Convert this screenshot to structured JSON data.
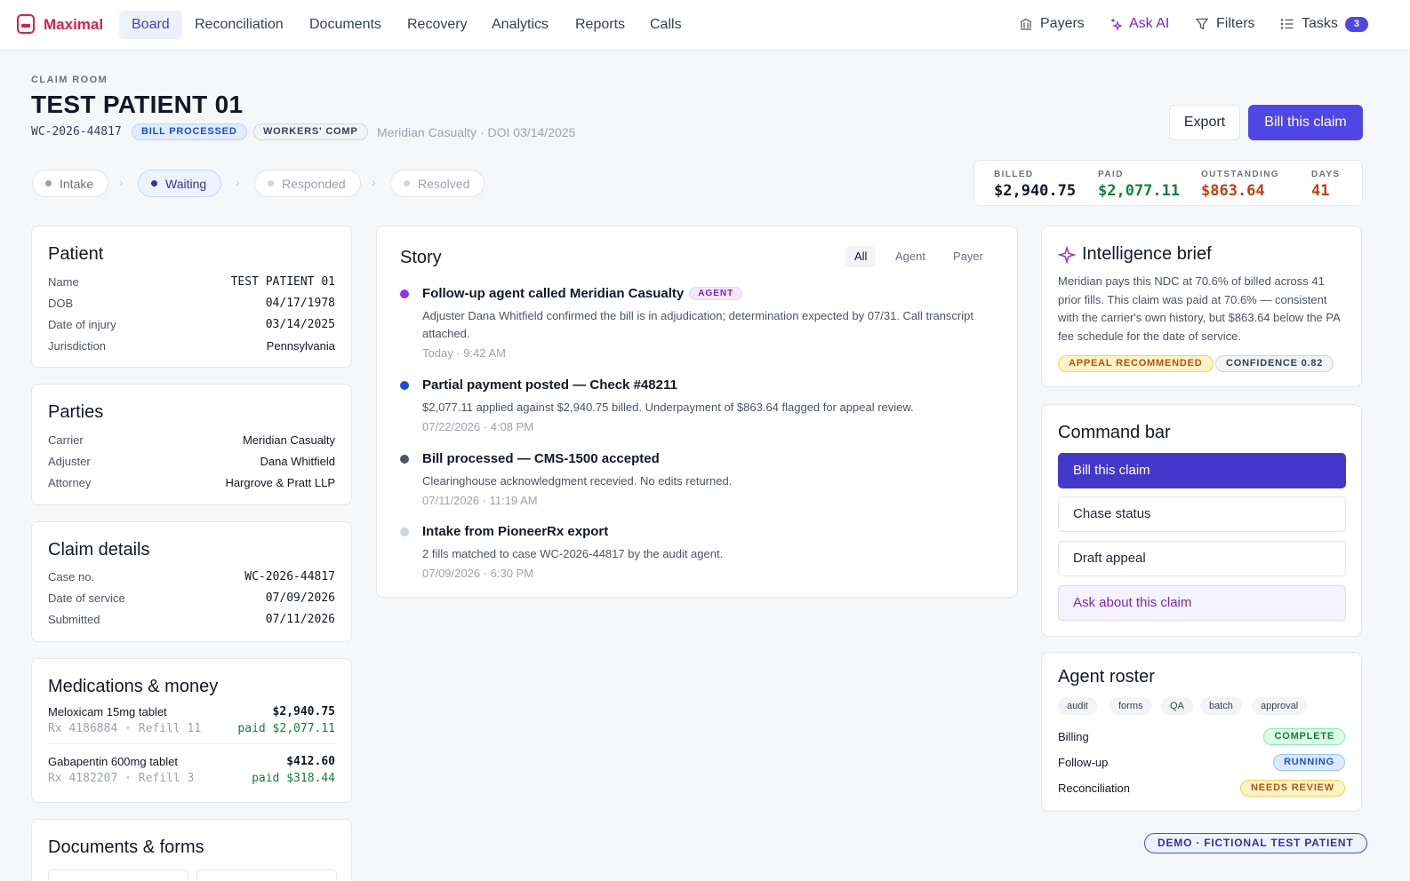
{
  "nav": {
    "brand": "Maximal",
    "tabs": [
      "Board",
      "Reconciliation",
      "Documents",
      "Recovery",
      "Analytics",
      "Reports",
      "Calls"
    ],
    "active_tab": "Board",
    "payers": "Payers",
    "ask_ai": "Ask AI",
    "filters": "Filters",
    "tasks": "Tasks",
    "tasks_count": "3"
  },
  "header": {
    "eyebrow": "CLAIM ROOM",
    "title": "TEST PATIENT 01",
    "case_id": "WC-2026-44817",
    "status_pill": "BILL PROCESSED",
    "type_pill": "WORKERS' COMP",
    "meta": "Meridian Casualty · DOI 03/14/2025",
    "export_label": "Export",
    "bill_label": "Bill this claim"
  },
  "steps": [
    "Intake",
    "Waiting",
    "Responded",
    "Resolved"
  ],
  "kpis": {
    "billed_label": "BILLED",
    "billed": "$2,940.75",
    "paid_label": "PAID",
    "paid": "$2,077.11",
    "outstanding_label": "OUTSTANDING",
    "outstanding": "$863.64",
    "days_label": "DAYS",
    "days": "41"
  },
  "colors": {
    "accent": "#4f46e5",
    "paid": "#15803d",
    "outstanding": "#c2410c"
  },
  "patient": {
    "title": "Patient",
    "rows": [
      {
        "k": "Name",
        "v": "TEST PATIENT 01"
      },
      {
        "k": "DOB",
        "v": "04/17/1978"
      },
      {
        "k": "Date of injury",
        "v": "03/14/2025"
      },
      {
        "k": "Jurisdiction",
        "v": "Pennsylvania"
      }
    ]
  },
  "parties": {
    "title": "Parties",
    "rows": [
      {
        "k": "Carrier",
        "v": "Meridian Casualty"
      },
      {
        "k": "Adjuster",
        "v": "Dana Whitfield"
      },
      {
        "k": "Attorney",
        "v": "Hargrove & Pratt LLP"
      }
    ]
  },
  "claim": {
    "title": "Claim details",
    "rows": [
      {
        "k": "Case no.",
        "v": "WC-2026-44817"
      },
      {
        "k": "Date of service",
        "v": "07/09/2026"
      },
      {
        "k": "Submitted",
        "v": "07/11/2026"
      }
    ]
  },
  "meds": {
    "title": "Medications & money",
    "items": [
      {
        "name": "Meloxicam 15mg tablet",
        "billed": "$2,940.75",
        "rx": "Rx 4186884 · Refill 11",
        "paid": "paid $2,077.11"
      },
      {
        "name": "Gabapentin 600mg tablet",
        "billed": "$412.60",
        "rx": "Rx 4182207 · Refill 3",
        "paid": "paid $318.44"
      }
    ]
  },
  "documents": {
    "title": "Documents & forms"
  },
  "story": {
    "title": "Story",
    "filters": [
      "All",
      "Agent",
      "Payer"
    ],
    "events": [
      {
        "title": "Follow-up agent called Meridian Casualty",
        "badge": "AGENT",
        "body": "Adjuster Dana Whitfield confirmed the bill is in adjudication; determination expected by 07/31. Call transcript attached.",
        "time": "Today · 9:42 AM",
        "color": "#9333ea"
      },
      {
        "title": "Partial payment posted — Check #48211",
        "badge": "",
        "body": "$2,077.11 applied against $2,940.75 billed. Underpayment of $863.64 flagged for appeal review.",
        "time": "07/22/2026 · 4:08 PM",
        "color": "#1d4ed8"
      },
      {
        "title": "Bill processed — CMS-1500 accepted",
        "badge": "",
        "body": "Clearinghouse acknowledgment recevied. No edits returned.",
        "time": "07/11/2026 · 11:19 AM",
        "color": "#4b5563"
      },
      {
        "title": "Intake from PioneerRx export",
        "badge": "",
        "body": "2 fills matched to case WC-2026-44817 by the audit agent.",
        "time": "07/09/2026 · 6:30 PM",
        "color": "#cbd5e1"
      }
    ]
  },
  "brief": {
    "title": "Intelligence brief",
    "body": "Meridian pays this NDC at 70.6% of billed across 41 prior fills. This claim was paid at 70.6% — consistent with the carrier's own history, but $863.64 below the PA fee schedule for the date of service.",
    "tag1": "APPEAL RECOMMENDED",
    "tag2": "CONFIDENCE 0.82"
  },
  "command": {
    "title": "Command bar",
    "bill": "Bill this claim",
    "chase": "Chase status",
    "draft": "Draft appeal",
    "ask": "Ask about this claim"
  },
  "roster": {
    "title": "Agent roster",
    "chips": [
      "audit",
      "forms",
      "QA",
      "batch",
      "approval"
    ],
    "rows": [
      {
        "name": "Billing",
        "status": "COMPLETE"
      },
      {
        "name": "Follow-up",
        "status": "RUNNING"
      },
      {
        "name": "Reconciliation",
        "status": "NEEDS REVIEW"
      }
    ]
  },
  "demo_badge": "DEMO · FICTIONAL TEST PATIENT"
}
